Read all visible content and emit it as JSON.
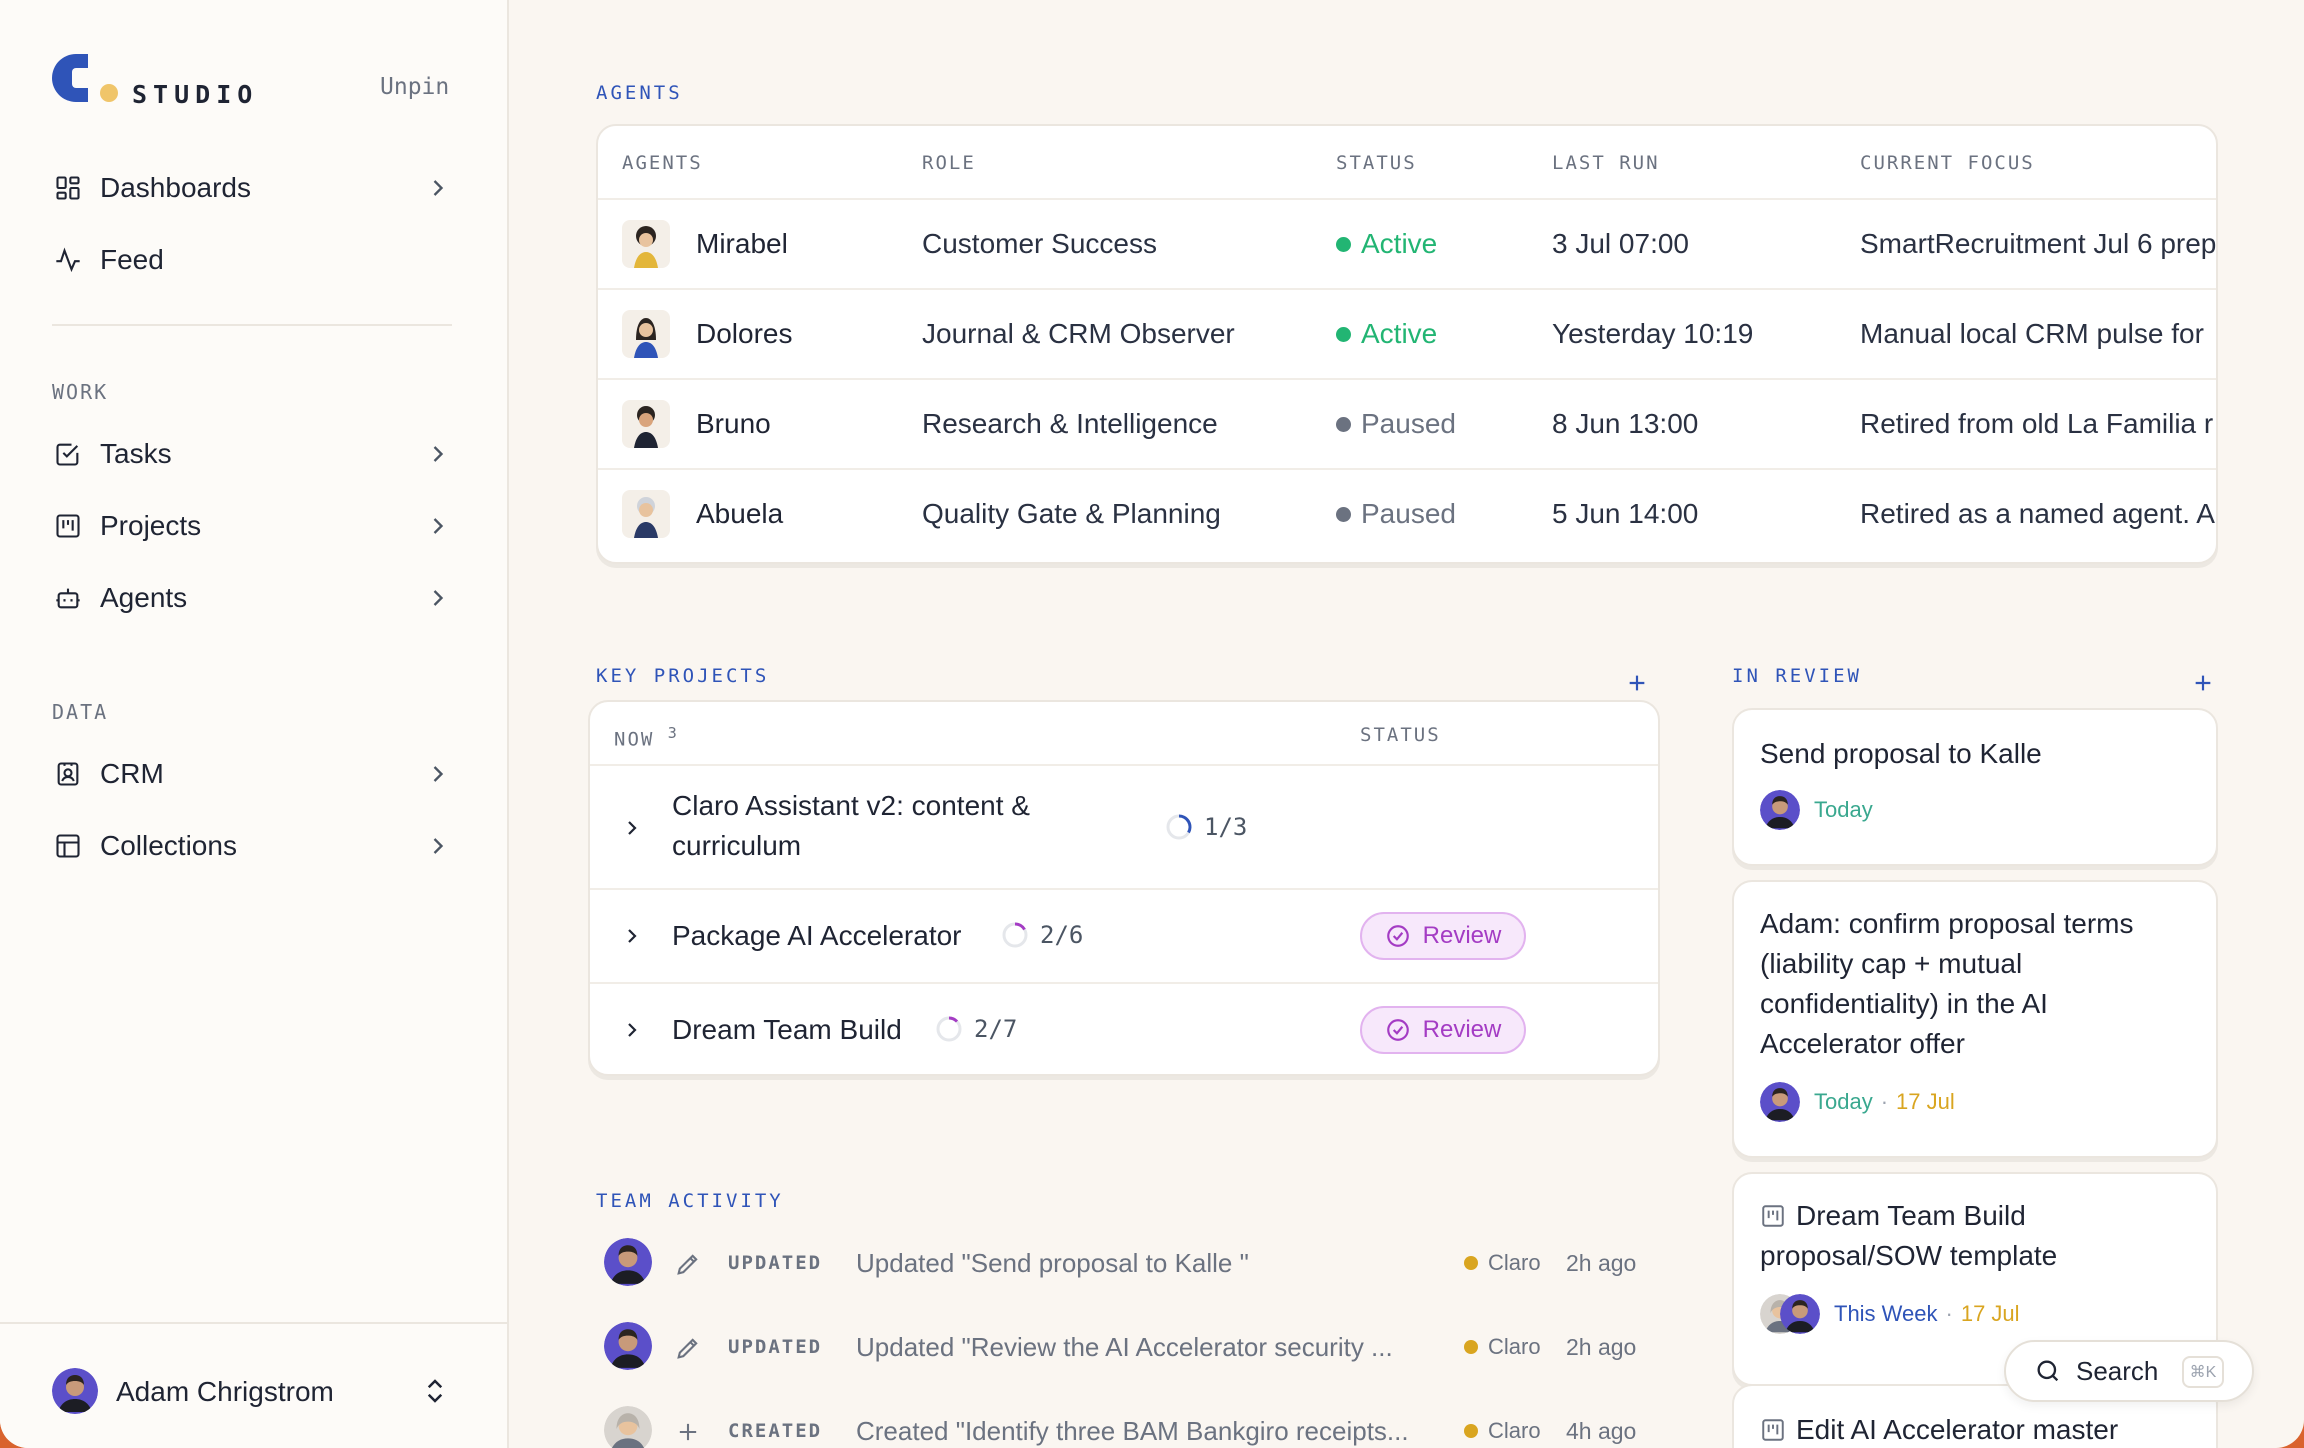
{
  "sidebar": {
    "brand": "STUDIO",
    "unpin": "Unpin",
    "top_items": [
      {
        "label": "Dashboards",
        "icon": "dashboard-icon"
      },
      {
        "label": "Feed",
        "icon": "activity-icon"
      }
    ],
    "work_label": "WORK",
    "work_items": [
      {
        "label": "Tasks",
        "icon": "checkbox-icon"
      },
      {
        "label": "Projects",
        "icon": "kanban-icon"
      },
      {
        "label": "Agents",
        "icon": "robot-icon"
      }
    ],
    "data_label": "DATA",
    "data_items": [
      {
        "label": "CRM",
        "icon": "contact-icon"
      },
      {
        "label": "Collections",
        "icon": "table-icon"
      }
    ],
    "user": {
      "name": "Adam Chrigstrom"
    }
  },
  "agents": {
    "section_label": "AGENTS",
    "columns": [
      "AGENTS",
      "ROLE",
      "STATUS",
      "LAST RUN",
      "CURRENT FOCUS"
    ],
    "rows": [
      {
        "name": "Mirabel",
        "role": "Customer Success",
        "status": "Active",
        "last_run": "3 Jul 07:00",
        "focus": "SmartRecruitment Jul 6 prep"
      },
      {
        "name": "Dolores",
        "role": "Journal & CRM Observer",
        "status": "Active",
        "last_run": "Yesterday 10:19",
        "focus": "Manual local CRM pulse for"
      },
      {
        "name": "Bruno",
        "role": "Research & Intelligence",
        "status": "Paused",
        "last_run": "8 Jun 13:00",
        "focus": "Retired from old La Familia r"
      },
      {
        "name": "Abuela",
        "role": "Quality Gate & Planning",
        "status": "Paused",
        "last_run": "5 Jun 14:00",
        "focus": "Retired as a named agent. A"
      }
    ],
    "colors": {
      "active": "#22b573",
      "paused": "#6b7280"
    }
  },
  "projects": {
    "section_label": "KEY PROJECTS",
    "col_now": "NOW",
    "now_count": "3",
    "col_status": "STATUS",
    "rows": [
      {
        "title_line1": "Claro Assistant v2: content &",
        "title_line2": "curriculum",
        "progress": "1/3",
        "status": ""
      },
      {
        "title_line1": "Package AI Accelerator",
        "progress": "2/6",
        "status": "Review"
      },
      {
        "title_line1": "Dream Team Build",
        "progress": "2/7",
        "status": "Review"
      }
    ]
  },
  "in_review": {
    "section_label": "IN REVIEW",
    "cards": [
      {
        "title": "Send proposal to Kalle",
        "when": "Today"
      },
      {
        "title_lines": [
          "Adam: confirm proposal terms",
          "(liability cap + mutual",
          "confidentiality) in the AI",
          "Accelerator offer"
        ],
        "when": "Today",
        "due": "17 Jul"
      },
      {
        "title_lines": [
          "Dream Team Build",
          "proposal/SOW template"
        ],
        "when": "This Week",
        "due": "17 Jul"
      },
      {
        "title_lines": [
          "Edit AI Accelerator master"
        ]
      }
    ]
  },
  "activity": {
    "section_label": "TEAM ACTIVITY",
    "rows": [
      {
        "verb": "UPDATED",
        "text": "Updated \"Send proposal to Kalle \"",
        "source": "Claro",
        "time": "2h ago"
      },
      {
        "verb": "UPDATED",
        "text": "Updated \"Review the AI Accelerator security ...",
        "source": "Claro",
        "time": "2h ago"
      },
      {
        "verb": "CREATED",
        "text": "Created \"Identify three BAM Bankgiro receipts...",
        "source": "Claro",
        "time": "4h ago"
      }
    ]
  },
  "search": {
    "label": "Search",
    "shortcut": "⌘K"
  }
}
